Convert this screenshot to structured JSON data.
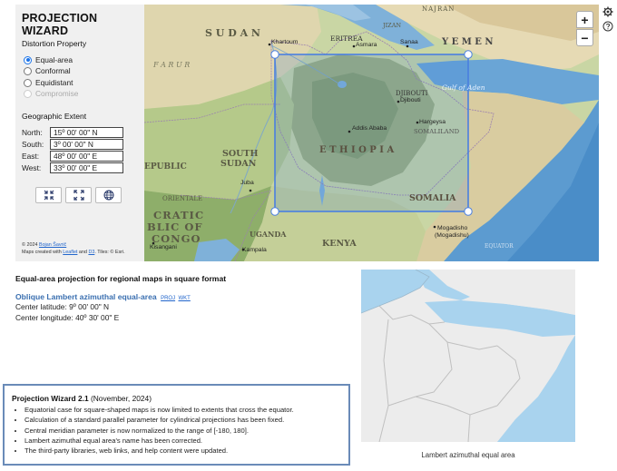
{
  "panel": {
    "title": "PROJECTION WIZARD",
    "distortion_heading": "Distortion Property",
    "options": [
      {
        "label": "Equal-area",
        "selected": true,
        "enabled": true
      },
      {
        "label": "Conformal",
        "selected": false,
        "enabled": true
      },
      {
        "label": "Equidistant",
        "selected": false,
        "enabled": true
      },
      {
        "label": "Compromise",
        "selected": false,
        "enabled": false
      }
    ],
    "extent_heading": "Geographic Extent",
    "extent": {
      "north": {
        "label": "North:",
        "value": "15º 00' 00\" N"
      },
      "south": {
        "label": "South:",
        "value": "3º 00' 00\" N"
      },
      "east": {
        "label": "East:",
        "value": "48º 00' 00\" E"
      },
      "west": {
        "label": "West:",
        "value": "33º 00' 00\" E"
      }
    },
    "buttons": [
      "shrink-extent-icon",
      "expand-extent-icon",
      "globe-icon"
    ],
    "credit_line1_prefix": "© 2024 ",
    "credit_author": "Bojan Šavrič",
    "credit_line2_prefix": "Maps created with ",
    "credit_leaflet": "Leaflet",
    "credit_and": " and ",
    "credit_d3": "D3",
    "credit_tiles": ". Tiles: © Esri."
  },
  "map": {
    "zoom_in": "+",
    "zoom_out": "−",
    "labels": {
      "najran": "NAJRAN",
      "jizan": "JIZAN",
      "sudan": "S U D A N",
      "eritrea": "ERITREA",
      "yemen": "Y E M E N",
      "khartoum": "Khartoum",
      "asmara": "Asmara",
      "sanaa": "Sanaa",
      "farur": "F A R U R",
      "djibouti_country": "DJIBOUTI",
      "djibouti_city": "Djibouti",
      "gulf_of_aden": "Gulf of Aden",
      "addis_ababa": "Addis Ababa",
      "hargeysa": "Hargeysa",
      "somaliland": "SOMALILAND",
      "ethiopia": "E T H I O P I A",
      "south_sudan_1": "SOUTH",
      "south_sudan_2": "SUDAN",
      "republic": "EPUBLIC",
      "juba": "Juba",
      "orientale": "ORIENTALE",
      "somalia": "SOMALIA",
      "cratic": "CRATIC",
      "blic_of": "BLIC OF",
      "congo": "CONGO",
      "uganda": "UGANDA",
      "kisangani": "Kisangani",
      "kampala": "Kampala",
      "kenya": "KENYA",
      "mogadishu_1": "Mogadisho",
      "mogadishu_2": "(Mogadishu)",
      "equator": "EQUATOR"
    }
  },
  "info": {
    "heading": "Equal-area projection for regional maps in square format",
    "projection_name": "Oblique Lambert azimuthal equal-area",
    "proj_link": "PROJ",
    "wkt_link": "WKT",
    "center_latitude": "Center latitude: 9º 00' 00\" N",
    "center_longitude": "Center longitude: 40º 30' 00\" E"
  },
  "changelog": {
    "title": "Projection Wizard  2.1",
    "date": " (November, 2024)",
    "items": [
      "Equatorial case for square-shaped maps is now limited to extents that cross the equator.",
      "Calculation of a standard parallel parameter for cylindrical projections has been fixed.",
      "Central meridian parameter is now normalized to the range of [-180, 180].",
      "Lambert azimuthal equal area's name has been corrected.",
      "The third-party libraries, web links, and help content were updated."
    ]
  },
  "preview": {
    "caption": "Lambert azimuthal equal area"
  },
  "colors": {
    "accent": "#1a73e8",
    "link": "#2266cc",
    "projection_name": "#3a6fb0",
    "extent_box": "#4a7fe0",
    "changelog_border": "#6a8bb8"
  }
}
